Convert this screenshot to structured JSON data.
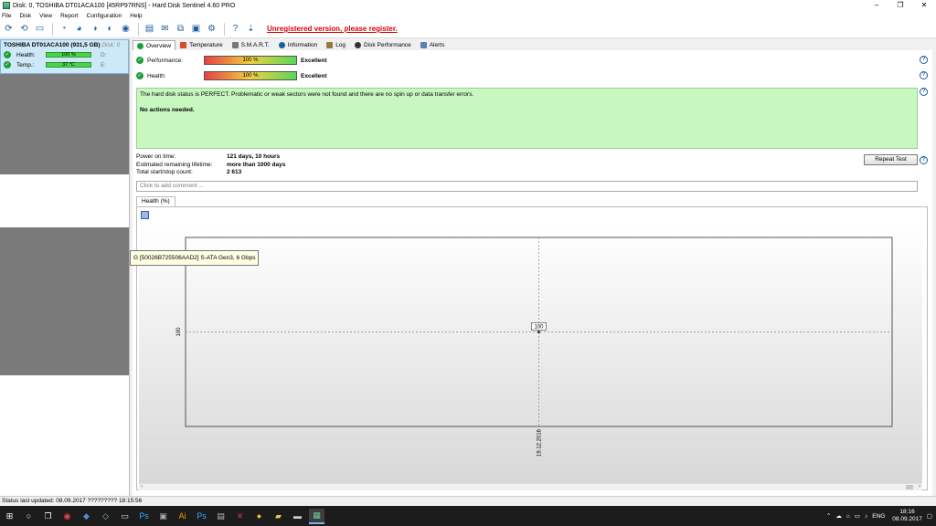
{
  "window": {
    "title": "Disk: 0, TOSHIBA DT01ACA100 [45RP97RNS]  -  Hard Disk Sentinel 4.60 PRO",
    "minimize": "–",
    "maximize": "❐",
    "close": "✕"
  },
  "menu": [
    "File",
    "Disk",
    "View",
    "Report",
    "Configuration",
    "Help"
  ],
  "toolbar": {
    "register_text": "Unregistered version, please register."
  },
  "disk": {
    "name": "TOSHIBA DT01ACA100",
    "size": "(931,5 GB)",
    "disk_no": "Disk: 0",
    "health_label": "Health:",
    "health_value": "100 %",
    "temp_label": "Temp.:",
    "temp_value": "37 °C",
    "drive1": "D:",
    "drive2": "E:"
  },
  "tabs": [
    {
      "label": "Overview",
      "color": "#1e9e3a"
    },
    {
      "label": "Temperature",
      "color": "#d84a2a"
    },
    {
      "label": "S.M.A.R.T.",
      "color": "#777777"
    },
    {
      "label": "Information",
      "color": "#1b5e9c"
    },
    {
      "label": "Log",
      "color": "#9a7a3a"
    },
    {
      "label": "Disk Performance",
      "color": "#333333"
    },
    {
      "label": "Alerts",
      "color": "#5a7fb8"
    }
  ],
  "overview": {
    "performance_label": "Performance:",
    "performance_value": "100 %",
    "performance_rating": "Excellent",
    "performance_fraction": 1.0,
    "health_label": "Health:",
    "health_value": "100 %",
    "health_rating": "Excellent",
    "status_text": "The hard disk status is PERFECT. Problematic or weak sectors were not found and there are no spin up or data transfer errors.",
    "actions_text": "No actions needed.",
    "power_on_label": "Power on time:",
    "power_on_value": "121 days, 10 hours",
    "lifetime_label": "Estimated remaining lifetime:",
    "lifetime_value": "more than 1000 days",
    "startstop_label": "Total start/stop count:",
    "startstop_value": "2 613",
    "repeat_button": "Repeat Test",
    "comment_placeholder": "Click to add comment ...",
    "help": "?"
  },
  "health_tab": "Health (%)",
  "chart_data": {
    "type": "line",
    "x": [
      "19.12.2016"
    ],
    "series": [
      {
        "values": [
          100
        ]
      }
    ],
    "point_labels": [
      "100"
    ],
    "ytick_labels": [
      "100"
    ],
    "xtick_labels": [
      "19.12.2016"
    ],
    "grid": true
  },
  "tooltip": "G [50026B725506AAD2]  S-ATA Gen3, 6 Gbps",
  "statusbar": "Status last updated: 08.09.2017 ????????? 18:15:56",
  "taskbar": {
    "lang": "ENG",
    "time": "18:16",
    "date": "08.09.2017"
  }
}
